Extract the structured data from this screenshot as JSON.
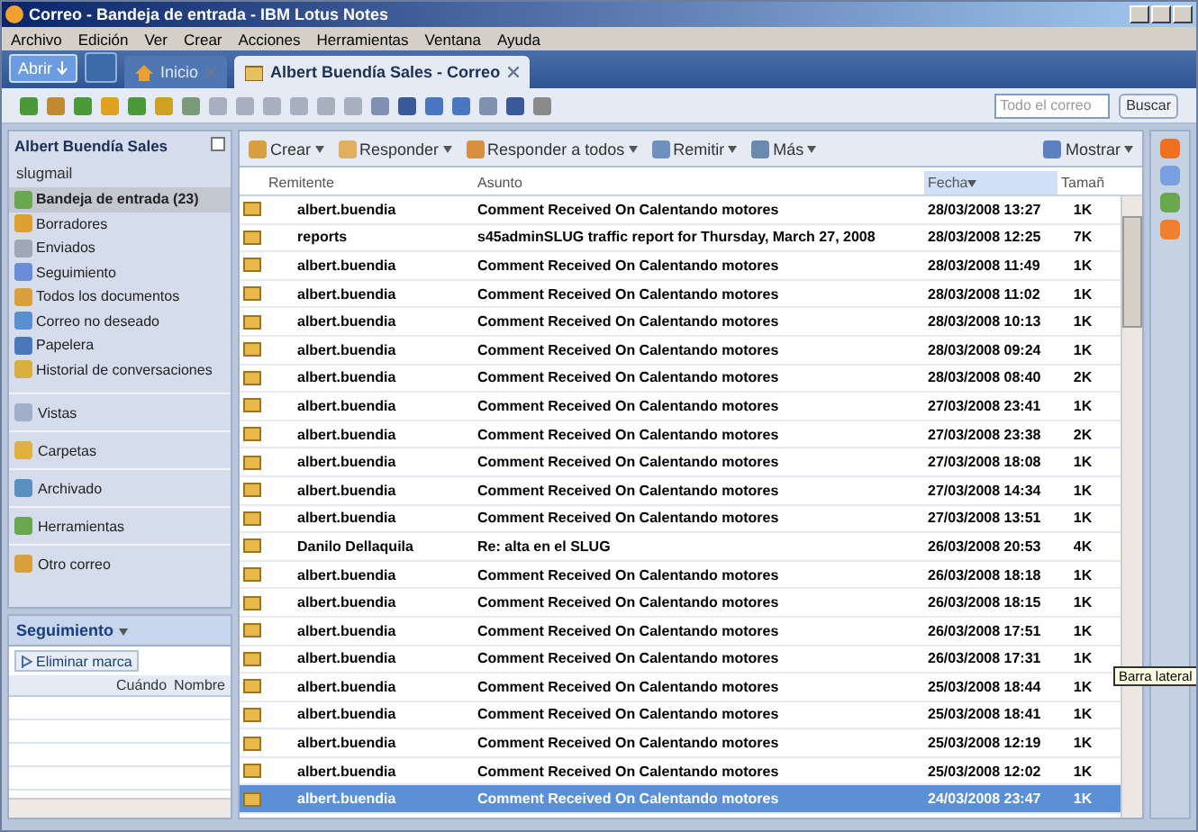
{
  "window": {
    "title": "Correo - Bandeja de entrada - IBM Lotus Notes"
  },
  "menu": [
    "Archivo",
    "Edición",
    "Ver",
    "Crear",
    "Acciones",
    "Herramientas",
    "Ventana",
    "Ayuda"
  ],
  "open_button": "Abrir",
  "tabs": [
    {
      "label": "Inicio",
      "selected": false
    },
    {
      "label": "Albert Buendía Sales - Correo",
      "selected": true
    }
  ],
  "search": {
    "placeholder": "Todo el correo",
    "button": "Buscar"
  },
  "navigator": {
    "account": "Albert Buendía Sales",
    "server": "slugmail",
    "items": [
      {
        "label": "Bandeja de entrada (23)",
        "selected": true
      },
      {
        "label": "Borradores",
        "selected": false
      },
      {
        "label": "Enviados",
        "selected": false
      },
      {
        "label": "Seguimiento",
        "selected": false
      },
      {
        "label": "Todos los documentos",
        "selected": false
      },
      {
        "label": "Correo no deseado",
        "selected": false
      },
      {
        "label": "Papelera",
        "selected": false
      },
      {
        "label": "Historial de conversaciones",
        "selected": false
      }
    ],
    "sections": [
      "Vistas",
      "Carpetas",
      "Archivado",
      "Herramientas",
      "Otro correo"
    ]
  },
  "followup": {
    "title": "Seguimiento",
    "button": "Eliminar marca",
    "columns": [
      "Cuándo",
      "Nombre"
    ]
  },
  "actions": [
    "Crear",
    "Responder",
    "Responder a todos",
    "Remitir",
    "Más"
  ],
  "show_button": "Mostrar",
  "columns": [
    "Remitente",
    "Asunto",
    "Fecha",
    "Tamañ"
  ],
  "rows": [
    {
      "from": "albert.buendia",
      "subject": "Comment Received On Calentando motores",
      "date": "28/03/2008 13:27",
      "size": "1K",
      "selected": false
    },
    {
      "from": "reports",
      "subject": "s45adminSLUG traffic report for Thursday, March 27, 2008",
      "date": "28/03/2008 12:25",
      "size": "7K",
      "selected": false
    },
    {
      "from": "albert.buendia",
      "subject": "Comment Received On Calentando motores",
      "date": "28/03/2008 11:49",
      "size": "1K",
      "selected": false
    },
    {
      "from": "albert.buendia",
      "subject": "Comment Received On Calentando motores",
      "date": "28/03/2008 11:02",
      "size": "1K",
      "selected": false
    },
    {
      "from": "albert.buendia",
      "subject": "Comment Received On Calentando motores",
      "date": "28/03/2008 10:13",
      "size": "1K",
      "selected": false
    },
    {
      "from": "albert.buendia",
      "subject": "Comment Received On Calentando motores",
      "date": "28/03/2008 09:24",
      "size": "1K",
      "selected": false
    },
    {
      "from": "albert.buendia",
      "subject": "Comment Received On Calentando motores",
      "date": "28/03/2008 08:40",
      "size": "2K",
      "selected": false
    },
    {
      "from": "albert.buendia",
      "subject": "Comment Received On Calentando motores",
      "date": "27/03/2008 23:41",
      "size": "1K",
      "selected": false
    },
    {
      "from": "albert.buendia",
      "subject": "Comment Received On Calentando motores",
      "date": "27/03/2008 23:38",
      "size": "2K",
      "selected": false
    },
    {
      "from": "albert.buendia",
      "subject": "Comment Received On Calentando motores",
      "date": "27/03/2008 18:08",
      "size": "1K",
      "selected": false
    },
    {
      "from": "albert.buendia",
      "subject": "Comment Received On Calentando motores",
      "date": "27/03/2008 14:34",
      "size": "1K",
      "selected": false
    },
    {
      "from": "albert.buendia",
      "subject": "Comment Received On Calentando motores",
      "date": "27/03/2008 13:51",
      "size": "1K",
      "selected": false
    },
    {
      "from": "Danilo Dellaquila",
      "subject": "Re: alta en el SLUG",
      "date": "26/03/2008 20:53",
      "size": "4K",
      "selected": false
    },
    {
      "from": "albert.buendia",
      "subject": "Comment Received On Calentando motores",
      "date": "26/03/2008 18:18",
      "size": "1K",
      "selected": false
    },
    {
      "from": "albert.buendia",
      "subject": "Comment Received On Calentando motores",
      "date": "26/03/2008 18:15",
      "size": "1K",
      "selected": false
    },
    {
      "from": "albert.buendia",
      "subject": "Comment Received On Calentando motores",
      "date": "26/03/2008 17:51",
      "size": "1K",
      "selected": false
    },
    {
      "from": "albert.buendia",
      "subject": "Comment Received On Calentando motores",
      "date": "26/03/2008 17:31",
      "size": "1K",
      "selected": false
    },
    {
      "from": "albert.buendia",
      "subject": "Comment Received On Calentando motores",
      "date": "25/03/2008 18:44",
      "size": "1K",
      "selected": false
    },
    {
      "from": "albert.buendia",
      "subject": "Comment Received On Calentando motores",
      "date": "25/03/2008 18:41",
      "size": "1K",
      "selected": false
    },
    {
      "from": "albert.buendia",
      "subject": "Comment Received On Calentando motores",
      "date": "25/03/2008 12:19",
      "size": "1K",
      "selected": false
    },
    {
      "from": "albert.buendia",
      "subject": "Comment Received On Calentando motores",
      "date": "25/03/2008 12:02",
      "size": "1K",
      "selected": false
    },
    {
      "from": "albert.buendia",
      "subject": "Comment Received On Calentando motores",
      "date": "24/03/2008 23:47",
      "size": "1K",
      "selected": true
    }
  ],
  "tooltip": "Barra lateral"
}
